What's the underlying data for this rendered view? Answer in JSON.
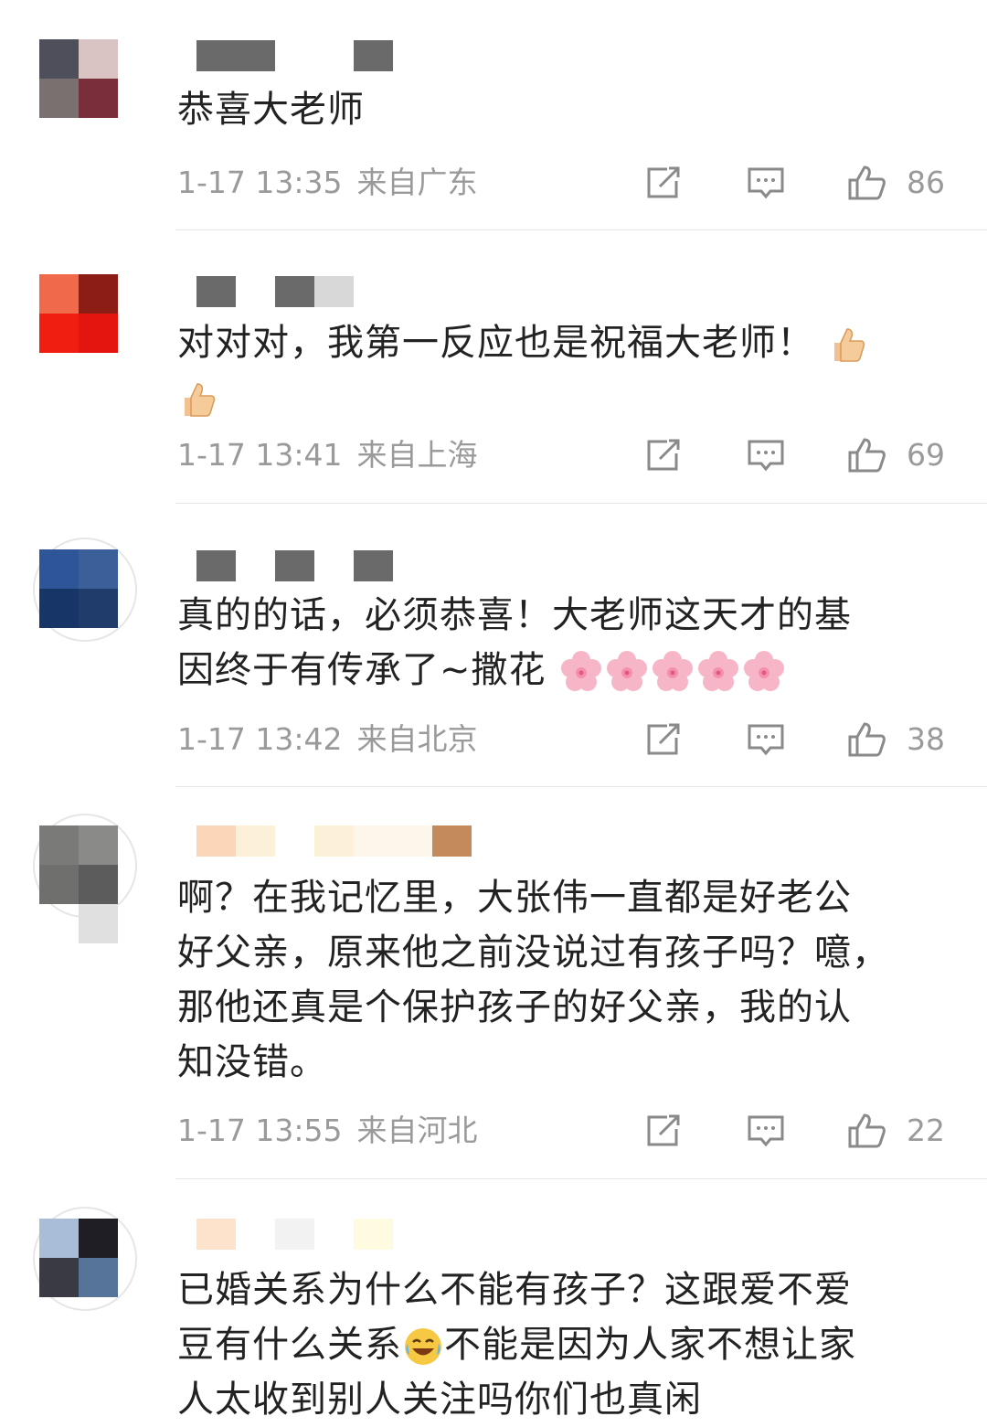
{
  "comments": [
    {
      "text": "恭喜大老师",
      "time": "1-17 13:35",
      "location": "来自广东",
      "likes": "86",
      "avatar_colors": [
        "#4f4f5c",
        "#d9c3c3",
        "#7a7070",
        "#7a2d3b"
      ]
    },
    {
      "text": "对对对，我第一反应也是祝福大老师！",
      "emoji_after": [
        "thumbs-up",
        "thumbs-up"
      ],
      "time": "1-17 13:41",
      "location": "来自上海",
      "likes": "69",
      "avatar_colors": [
        "#f0694a",
        "#8c1d14",
        "#f01e10",
        "#e3150e"
      ]
    },
    {
      "text_line1": "真的的话，必须恭喜！大老师这天才的基",
      "text_line2": "因终于有传承了~撒花",
      "emoji_after": [
        "sakura",
        "sakura",
        "sakura",
        "sakura",
        "sakura"
      ],
      "time": "1-17 13:42",
      "location": "来自北京",
      "likes": "38",
      "avatar_colors": [
        "#2e5597",
        "#3a5f99",
        "#173567",
        "#1f3c6b"
      ]
    },
    {
      "text_line1": "啊？在我记忆里，大张伟一直都是好老公",
      "text_line2": "好父亲，原来他之前没说过有孩子吗？噫，",
      "text_line3": "那他还真是个保护孩子的好父亲，我的认",
      "text_line4": "知没错。",
      "time": "1-17 13:55",
      "location": "来自河北",
      "likes": "22",
      "avatar_colors": [
        "#7a7a78",
        "#8a8a88",
        "#6f706e",
        "#5c5c5c"
      ]
    },
    {
      "text_line1": "已婚关系为什么不能有孩子？这跟爱不爱",
      "text_line2a": "豆有什么关系",
      "text_line2b": "不能是因为人家不想让家",
      "text_line3": "人太收到别人关注吗你们也真闲",
      "avatar_colors": [
        "#a9bcd8",
        "#1e1e24",
        "#3a3a44",
        "#56739a"
      ]
    }
  ]
}
